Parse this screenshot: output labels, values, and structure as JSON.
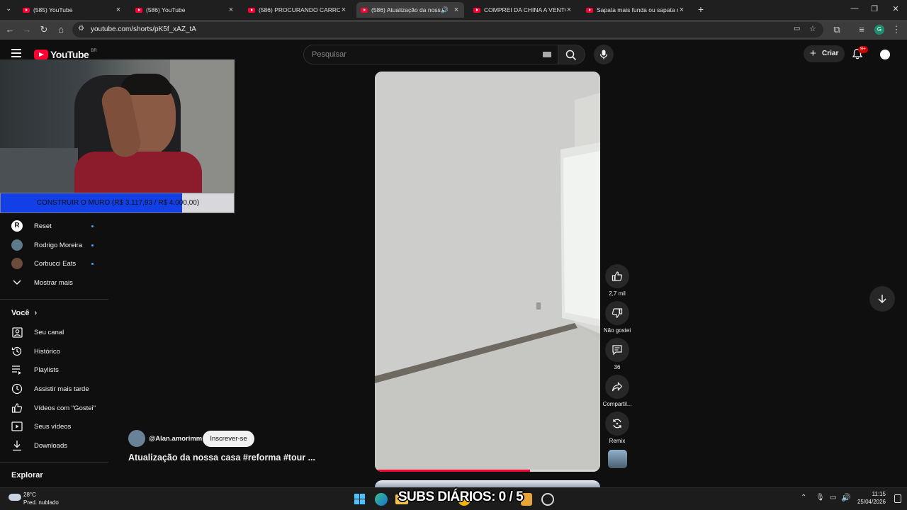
{
  "browser": {
    "tabs": [
      {
        "title": "(585) YouTube",
        "active": false
      },
      {
        "title": "(586) YouTube",
        "active": false
      },
      {
        "title": "(586) PROCURANDO CARRO DE",
        "active": false
      },
      {
        "title": "(586) Atualização da nossa",
        "active": true,
        "audio": true
      },
      {
        "title": "COMPREI DA CHINA A VENTOI",
        "active": false
      },
      {
        "title": "Sapata mais funda ou sapata m",
        "active": false
      }
    ],
    "url": "youtube.com/shorts/pK5f_xAZ_tA",
    "profile_initial": "G"
  },
  "youtube": {
    "logo_text": "YouTube",
    "region": "BR",
    "search_placeholder": "Pesquisar",
    "create_label": "Criar",
    "notifications_badge": "9+"
  },
  "overlay": {
    "goal_text": "CONSTRUIR O MURO (R$ 3.117,93 / R$ 4.000,00)",
    "goal_progress": 0.779
  },
  "sidebar": {
    "subscriptions": [
      {
        "label": "Reset"
      },
      {
        "label": "Rodrigo Moreira"
      },
      {
        "label": "Corbucci Eats"
      }
    ],
    "show_more": "Mostrar mais",
    "you_heading": "Você",
    "you_items": [
      {
        "label": "Seu canal",
        "icon": "channel-icon"
      },
      {
        "label": "Histórico",
        "icon": "history-icon"
      },
      {
        "label": "Playlists",
        "icon": "playlists-icon"
      },
      {
        "label": "Assistir mais tarde",
        "icon": "watch-later-icon"
      },
      {
        "label": "Vídeos com \"Gostei\"",
        "icon": "liked-icon"
      },
      {
        "label": "Seus vídeos",
        "icon": "your-videos-icon"
      },
      {
        "label": "Downloads",
        "icon": "download-icon"
      }
    ],
    "explore_heading": "Explorar"
  },
  "short": {
    "channel": "@Alan.amorimm",
    "subscribe_label": "Inscrever-se",
    "title": "Atualização da nossa casa #reforma #tour ...",
    "progress": 0.69,
    "actions": {
      "likes": "2,7 mil",
      "dislike_label": "Não gostei",
      "comments": "36",
      "share_label": "Compartil...",
      "remix_label": "Remix"
    }
  },
  "taskbar": {
    "weather_temp": "28°C",
    "weather_desc": "Pred. nublado",
    "overlay_text": "SUBS DIÁRIOS: 0 / 5",
    "time": "11:15",
    "date": "25/04/2026"
  }
}
